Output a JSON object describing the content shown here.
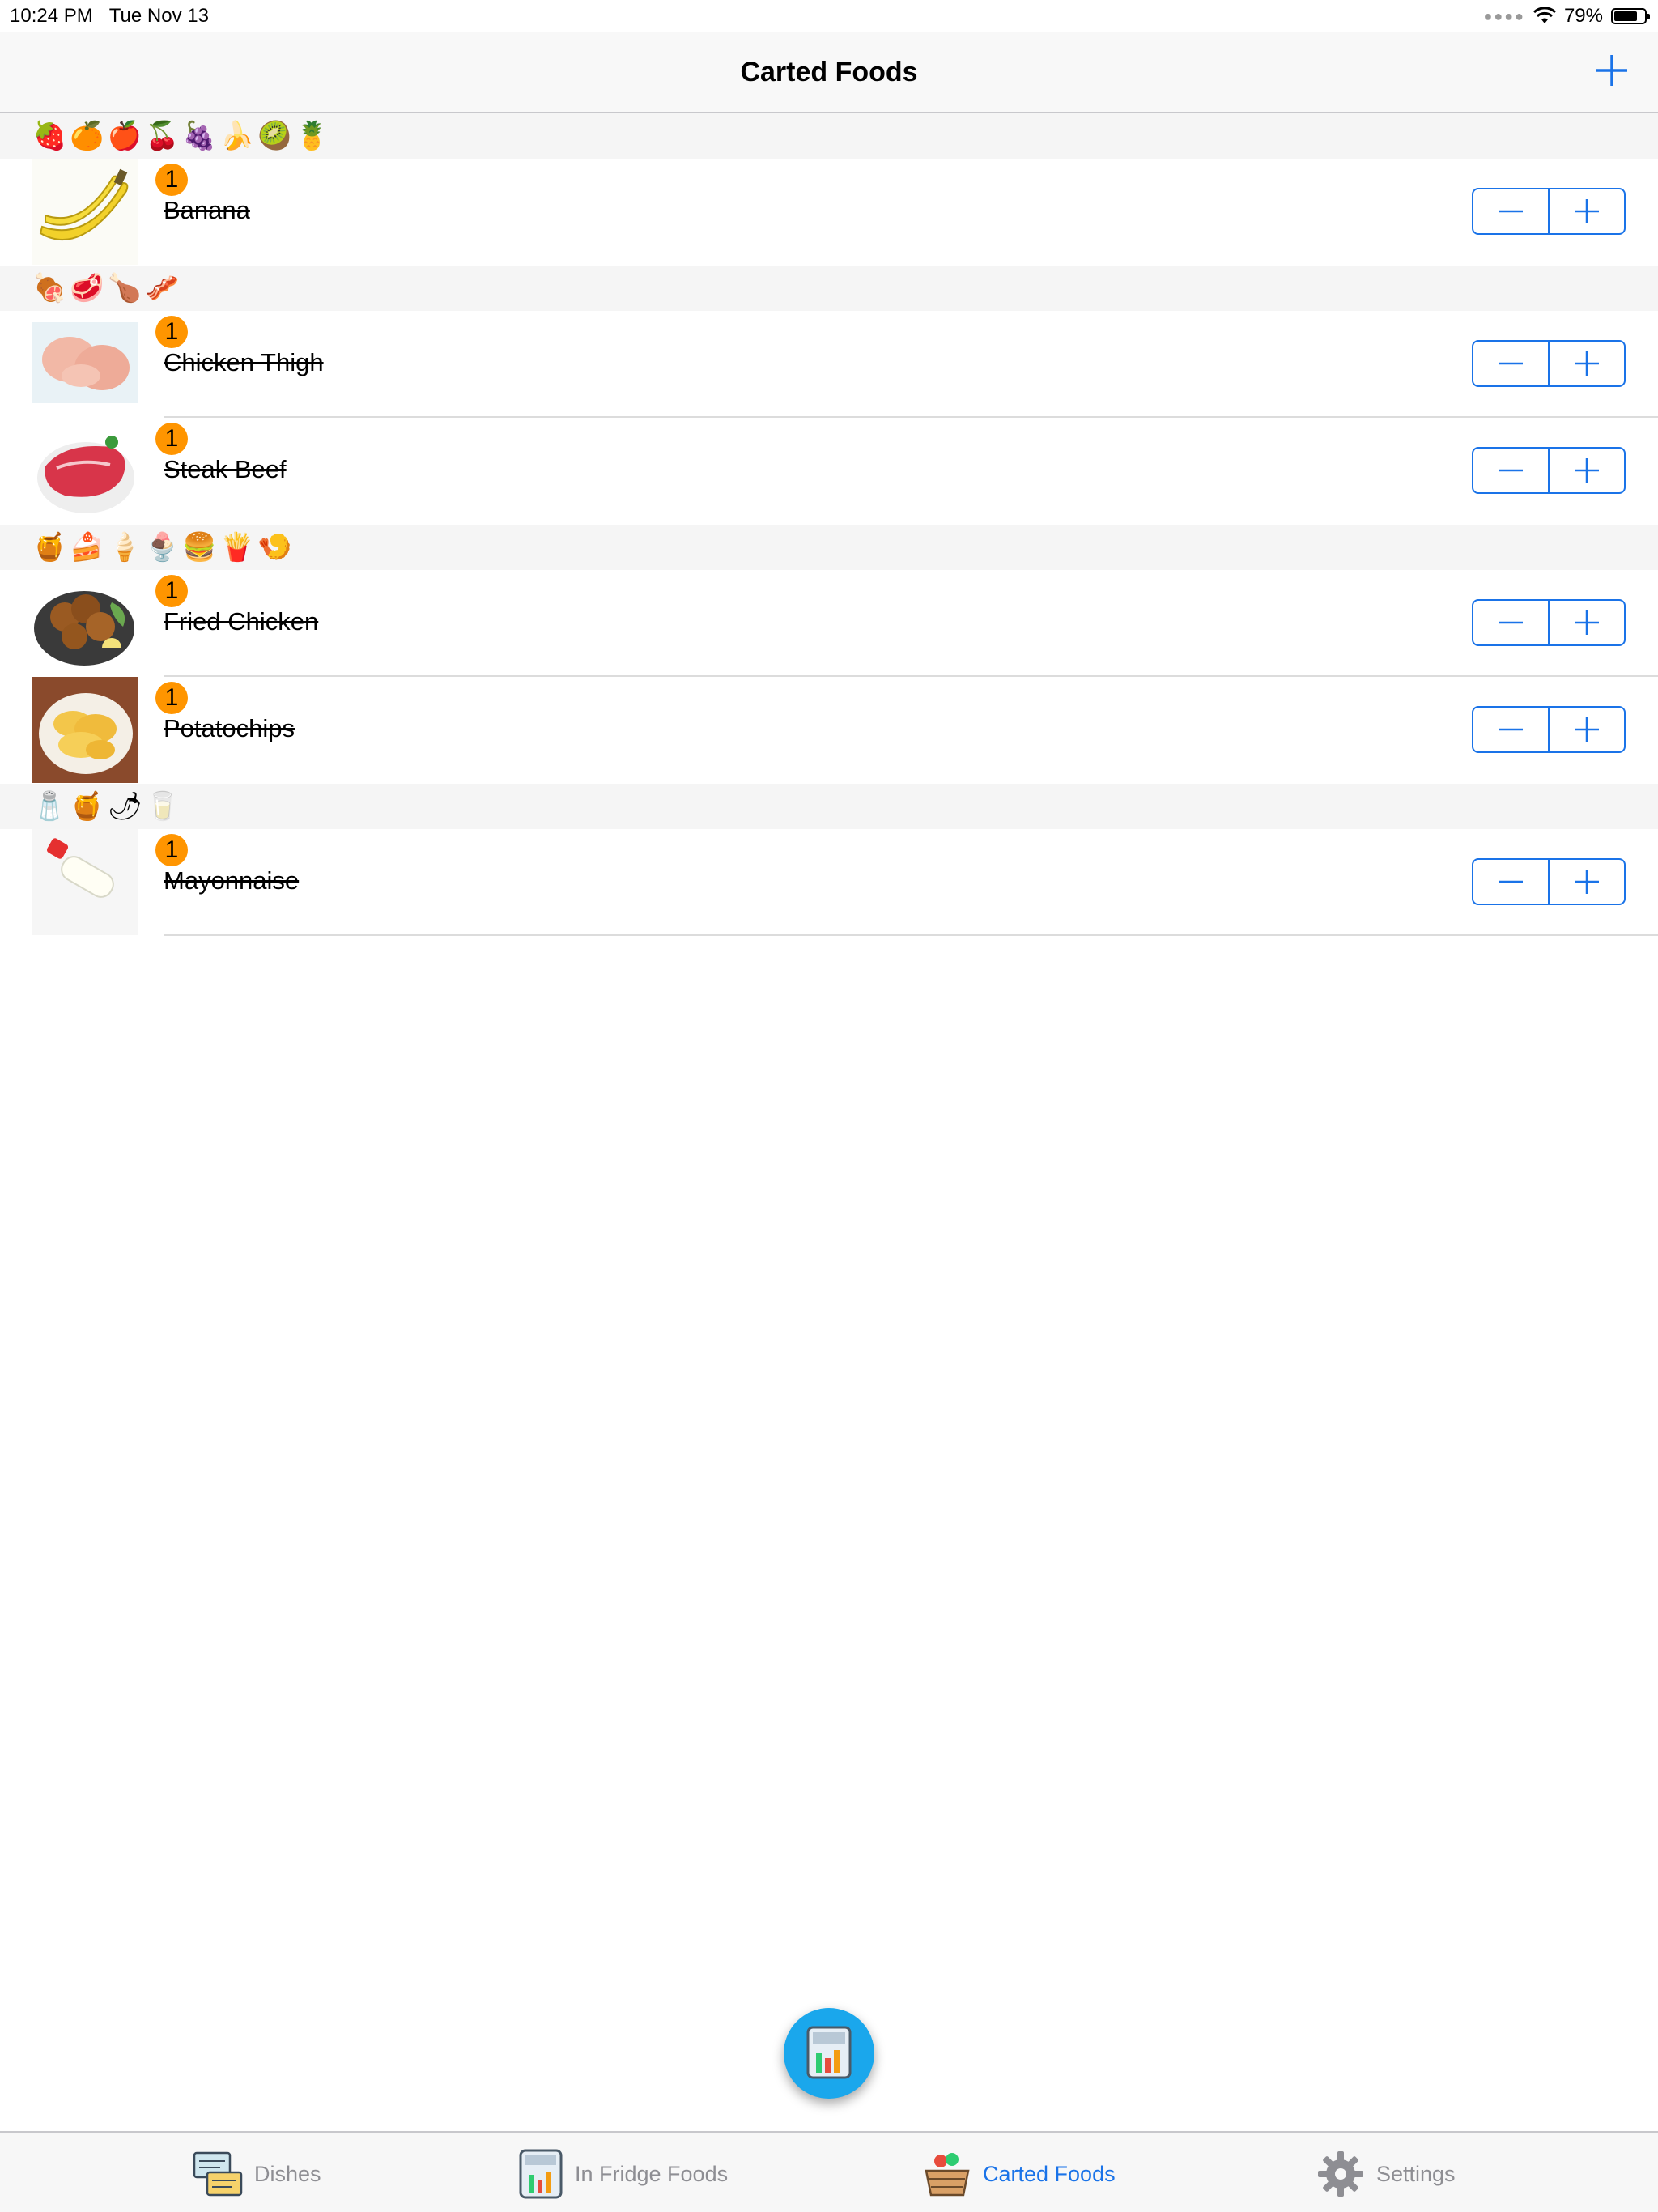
{
  "status_bar": {
    "time": "10:24 PM",
    "date": "Tue Nov 13",
    "battery_percent": "79%",
    "battery_level": 0.79
  },
  "nav": {
    "title": "Carted Foods",
    "add_icon": "plus-icon"
  },
  "sections": [
    {
      "emojis": "🍓🍊🍎🍒🍇🍌🥝🍍",
      "items": [
        {
          "name": "Banana",
          "count": "1"
        }
      ]
    },
    {
      "emojis": "🍖🥩🍗🥓",
      "items": [
        {
          "name": "Chicken Thigh",
          "count": "1"
        },
        {
          "name": "Steak Beef",
          "count": "1"
        }
      ]
    },
    {
      "emojis": "🍯🍰🍦🍨🍔🍟🍤",
      "items": [
        {
          "name": "Fried Chicken",
          "count": "1"
        },
        {
          "name": "Potatochips",
          "count": "1"
        }
      ]
    },
    {
      "emojis": "🧂🍯🌶🥛",
      "items": [
        {
          "name": "Mayonnaise",
          "count": "1"
        }
      ]
    }
  ],
  "fab": {
    "icon": "fridge-icon"
  },
  "tabs": [
    {
      "label": "Dishes",
      "icon": "dishes-icon",
      "active": false
    },
    {
      "label": "In Fridge Foods",
      "icon": "fridge-icon",
      "active": false
    },
    {
      "label": "Carted Foods",
      "icon": "basket-icon",
      "active": true
    },
    {
      "label": "Settings",
      "icon": "gear-icon",
      "active": false
    }
  ],
  "colors": {
    "accent": "#1a73e8",
    "badge": "#ff9500",
    "fab": "#1aa7ec",
    "section_header_bg": "#f5f5f5"
  }
}
